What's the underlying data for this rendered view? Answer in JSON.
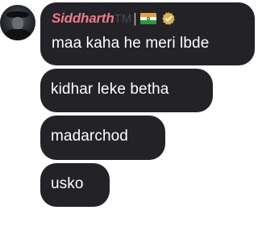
{
  "chat": {
    "sender": {
      "name": "Siddharth",
      "name_suffix": "TM",
      "separator": "|",
      "name_color": "#ef7a83",
      "flag_icon": "india-flag-icon",
      "badge_icon": "verified-badge-icon"
    },
    "messages": [
      {
        "text": "maa kaha he meri lbde"
      },
      {
        "text": "kidhar leke betha"
      },
      {
        "text": "madarchod"
      },
      {
        "text": "usko"
      }
    ],
    "bubble_color": "#232227",
    "text_color": "#ffffff"
  }
}
